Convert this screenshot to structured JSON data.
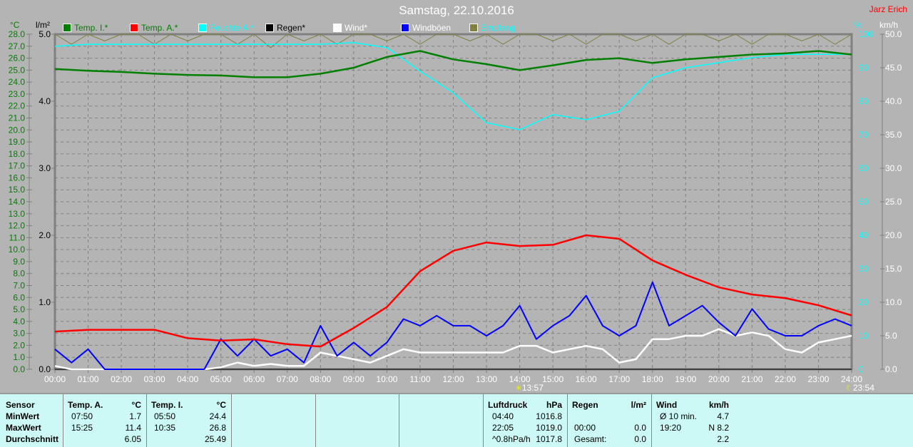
{
  "header": {
    "title": "Samstag, 22.10.2016",
    "owner": "Jarz Erich"
  },
  "legend": [
    {
      "label": "Temp. I.*",
      "color": "#008000",
      "text_color": "#008000"
    },
    {
      "label": "Temp. A.*",
      "color": "#ff0000",
      "text_color": "#008000"
    },
    {
      "label": "Feuchte A.*",
      "color": "#00ffff",
      "text_color": "#00ffff"
    },
    {
      "label": "Regen*",
      "color": "#000000",
      "text_color": "#000000"
    },
    {
      "label": "Wind*",
      "color": "#ffffff",
      "text_color": "#ffffff"
    },
    {
      "label": "Windböen",
      "color": "#0000ff",
      "text_color": "#ffffff"
    },
    {
      "label": "Empfang",
      "color": "#808040",
      "text_color": "#00ffff"
    }
  ],
  "markers": [
    {
      "time": "13:57"
    },
    {
      "time": "23:54"
    }
  ],
  "chart_data": {
    "type": "line",
    "title": "Samstag, 22.10.2016",
    "x_labels": [
      "00:00",
      "01:00",
      "02:00",
      "03:00",
      "04:00",
      "05:00",
      "06:00",
      "07:00",
      "08:00",
      "09:00",
      "10:00",
      "11:00",
      "12:00",
      "13:00",
      "14:00",
      "15:00",
      "16:00",
      "17:00",
      "18:00",
      "19:00",
      "20:00",
      "21:00",
      "22:00",
      "23:00",
      "24:00"
    ],
    "axes": {
      "temp": {
        "unit": "°C",
        "range": [
          0,
          28
        ],
        "step": 1
      },
      "rain": {
        "unit": "l/m²",
        "range": [
          0,
          5
        ],
        "step": 1
      },
      "humidity": {
        "unit": "%",
        "range": [
          0,
          100
        ],
        "step": 10
      },
      "wind": {
        "unit": "km/h",
        "range": [
          0,
          50
        ],
        "step": 5
      }
    },
    "grid": true,
    "series": [
      {
        "name": "Temp. I.",
        "axis": "temp",
        "color": "#008000",
        "hours_step": 1,
        "values": [
          25.1,
          24.95,
          24.85,
          24.7,
          24.6,
          24.55,
          24.4,
          24.4,
          24.7,
          25.2,
          26.1,
          26.6,
          25.9,
          25.5,
          25.0,
          25.4,
          25.85,
          26.0,
          25.6,
          25.9,
          26.1,
          26.3,
          26.4,
          26.6,
          26.3
        ]
      },
      {
        "name": "Temp. A.",
        "axis": "temp",
        "color": "#ff0000",
        "hours_step": 1,
        "values": [
          3.15,
          3.3,
          3.3,
          3.3,
          2.6,
          2.4,
          2.5,
          2.1,
          1.9,
          3.45,
          5.2,
          8.2,
          9.9,
          10.6,
          10.3,
          10.4,
          11.2,
          10.9,
          9.1,
          7.9,
          6.85,
          6.25,
          5.95,
          5.35,
          4.5
        ]
      },
      {
        "name": "Feuchte A.",
        "axis": "humidity",
        "color": "#00ffff",
        "hours_step": 1,
        "values": [
          96.4,
          97,
          97,
          97,
          97,
          97,
          97,
          97,
          97,
          97.5,
          96,
          89,
          82.5,
          73.6,
          71.5,
          76,
          74.5,
          77,
          87,
          90,
          91.5,
          93,
          94,
          94,
          94
        ]
      },
      {
        "name": "Regen",
        "axis": "rain",
        "color": "#000000",
        "hours_step": 24,
        "values": [
          0,
          0
        ]
      },
      {
        "name": "Wind",
        "axis": "wind",
        "color": "#ffffff",
        "hours_step": 0.5,
        "values": [
          0.5,
          0,
          0,
          0,
          0,
          0,
          0,
          0,
          0,
          0,
          0.3,
          1,
          0.5,
          0.8,
          0.5,
          0.5,
          2.5,
          2,
          1.5,
          1,
          2,
          3,
          2.5,
          2.5,
          2.5,
          2.5,
          2.5,
          2.5,
          3.5,
          3.5,
          2.5,
          3,
          3.5,
          3,
          1,
          1.5,
          4.5,
          4.5,
          5,
          5,
          6,
          5,
          5.5,
          5,
          3,
          2.5,
          4,
          4.5,
          5
        ]
      },
      {
        "name": "Windböen",
        "axis": "wind",
        "color": "#0000ff",
        "hours_step": 0.5,
        "values": [
          3,
          1,
          3,
          0,
          0,
          0,
          0,
          0,
          0,
          0,
          4.5,
          2,
          4.5,
          2,
          3,
          1,
          6.5,
          2,
          4,
          2,
          4,
          7.5,
          6.5,
          8,
          6.5,
          6.5,
          5,
          6.5,
          9.5,
          4.5,
          6.5,
          8,
          11,
          6.5,
          5,
          6.5,
          13,
          6.5,
          8,
          9.5,
          7,
          5,
          9,
          6,
          5,
          5,
          6.5,
          7.5,
          6.5
        ]
      },
      {
        "name": "Empfang",
        "axis": "humidity",
        "color": "#808040",
        "hours_step": 0.5,
        "values": [
          100,
          97,
          100,
          98,
          100,
          100,
          97,
          100,
          98,
          100,
          100,
          97,
          100,
          96,
          100,
          98,
          100,
          97,
          100,
          100,
          98,
          100,
          97,
          100,
          100,
          98,
          100,
          97,
          100,
          100,
          98,
          100,
          97,
          100,
          100,
          98,
          100,
          97,
          100,
          100,
          98,
          100,
          97,
          100,
          100,
          98,
          100,
          97,
          100
        ]
      }
    ]
  },
  "summary": {
    "sensor": {
      "header": "Sensor",
      "rows": [
        "MinWert",
        "MaxWert",
        "Durchschnitt"
      ]
    },
    "temp_a": {
      "header": "Temp. A.",
      "unit": "°C",
      "rows": [
        [
          "07:50",
          "1.7"
        ],
        [
          "15:25",
          "11.4"
        ],
        [
          "",
          "6.05"
        ]
      ]
    },
    "temp_i": {
      "header": "Temp. I.",
      "unit": "°C",
      "rows": [
        [
          "05:50",
          "24.4"
        ],
        [
          "10:35",
          "26.8"
        ],
        [
          "",
          "25.49"
        ]
      ]
    },
    "pressure": {
      "header": "Luftdruck",
      "unit": "hPa",
      "rows": [
        [
          "04:40",
          "1016.8"
        ],
        [
          "22:05",
          "1019.0"
        ],
        [
          "^0.8hPa/h",
          "1017.8"
        ]
      ]
    },
    "rain": {
      "header": "Regen",
      "unit": "l/m²",
      "rows": [
        [
          "",
          ""
        ],
        [
          "00:00",
          "0.0"
        ],
        [
          "Gesamt:",
          "0.0"
        ]
      ]
    },
    "wind": {
      "header": "Wind",
      "unit": "km/h",
      "rows": [
        [
          "Ø 10 min.",
          "4.7"
        ],
        [
          "19:20",
          "N 8.2"
        ],
        [
          "",
          "2.2"
        ]
      ]
    }
  }
}
